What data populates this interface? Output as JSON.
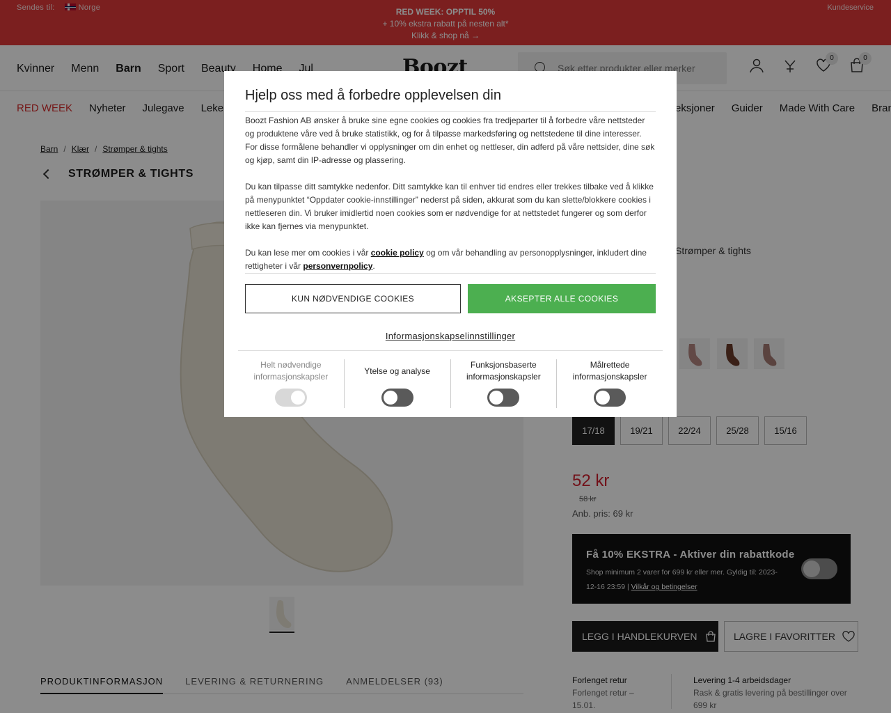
{
  "topbar": {
    "ship_label": "Sendes til:",
    "country": "Norge",
    "promo_line1": "RED WEEK: OPPTIL 50%",
    "promo_line2": "+ 10% ekstra rabatt på nesten alt*",
    "promo_line3": "Klikk & shop nå →",
    "service": "Kundeservice"
  },
  "header": {
    "nav": [
      "Kvinner",
      "Menn",
      "Barn",
      "Sport",
      "Beauty",
      "Home",
      "Jul"
    ],
    "active_nav": "Barn",
    "logo": "Boozt",
    "search_placeholder": "Søk etter produkter eller merker",
    "wishlist_count": "0",
    "cart_count": "0"
  },
  "catnav": {
    "left": [
      "RED WEEK",
      "Nyheter",
      "Julegave",
      "Leker"
    ],
    "right": [
      "eksjoner",
      "Guider",
      "Made With Care",
      "Brands"
    ]
  },
  "breadcrumb": [
    "Barn",
    "Klær",
    "Strømper & tights"
  ],
  "page_title": "STRØMPER & TIGHTS",
  "product": {
    "category_crumb": "Strømper & tights",
    "sizes": [
      "17/18",
      "19/21",
      "22/24",
      "25/28",
      "15/16"
    ],
    "selected_size": "17/18",
    "price": "52 kr",
    "old_price": "58 kr",
    "rrp": "Anb. pris: 69 kr",
    "discount_title": "Få 10% EKSTRA - Aktiver din rabattkode",
    "discount_text": "Shop minimum 2 varer for 699 kr eller mer. Gyldig til: 2023-12-16 23:59 |",
    "discount_terms": "Vilkår og betingelser",
    "add_to_cart": "LEGG I HANDLEKURVEN",
    "save_fav": "LAGRE I FAVORITTER",
    "return_title": "Forlenget retur",
    "return_text": "Forlenget retur – 15.01.",
    "delivery_title": "Levering 1-4 arbeidsdager",
    "delivery_text": "Rask & gratis levering på bestillinger over 699 kr"
  },
  "tabs": [
    "PRODUKTINFORMASJON",
    "LEVERING & RETURNERING",
    "ANMELDELSER (93)"
  ],
  "modal": {
    "title": "Hjelp oss med å forbedre opplevelsen din",
    "p1": "Boozt Fashion AB ønsker å bruke sine egne cookies og cookies fra tredjeparter til å forbedre våre nettsteder og produktene våre ved å bruke statistikk, og for å tilpasse markedsføring og nettstedene til dine interesser. For disse formålene behandler vi opplysninger om din enhet og nettleser, din adferd på våre nettsider, dine søk og kjøp, samt din IP-adresse og plassering.",
    "p2": "Du kan tilpasse ditt samtykke nedenfor. Ditt samtykke kan til enhver tid endres eller trekkes tilbake ved å klikke på menypunktet “Oppdater cookie-innstillinger” nederst på siden, akkurat som du kan slette/blokkere cookies i nettleseren din. Vi bruker imidlertid noen cookies som er nødvendige for at nettstedet fungerer og som derfor ikke kan fjernes via menypunktet.",
    "p3_a": "Du kan lese mer om cookies i vår ",
    "p3_link1": "cookie policy",
    "p3_b": " og om vår behandling av personopplysninger, inkludert dine rettigheter i vår ",
    "p3_link2": "personvernpolicy",
    "p3_c": ".",
    "btn_necessary": "KUN NØDVENDIGE COOKIES",
    "btn_accept": "AKSEPTER ALLE COOKIES",
    "settings_link": "Informasjonskapselinnstillinger",
    "categories": [
      {
        "label": "Helt nødvendige informasjonskapsler",
        "enabled": true,
        "locked": true
      },
      {
        "label": "Ytelse og analyse",
        "enabled": false,
        "locked": false
      },
      {
        "label": "Funksjonsbaserte informasjonskapsler",
        "enabled": false,
        "locked": false
      },
      {
        "label": "Målrettede informasjonskapsler",
        "enabled": false,
        "locked": false
      }
    ]
  },
  "colors": {
    "banner_red": "#e03a3a",
    "accept_green": "#4caf50",
    "price_red": "#d01f2f"
  }
}
